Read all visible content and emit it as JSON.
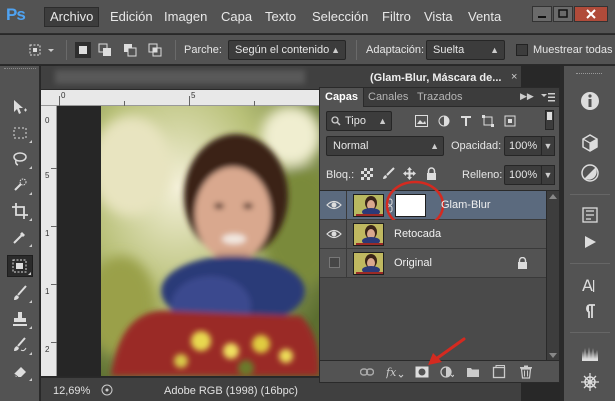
{
  "app": {
    "logo": "Ps"
  },
  "menu": {
    "items": [
      "Archivo",
      "Edición",
      "Imagen",
      "Capa",
      "Texto",
      "Selección",
      "Filtro",
      "Vista",
      "Venta"
    ],
    "active_index": 0
  },
  "options_bar": {
    "patch_label": "Parche:",
    "patch_value": "Según el contenido",
    "adaptation_label": "Adaptación:",
    "adaptation_value": "Suelta",
    "sample_all_label": "Muestrear todas"
  },
  "document": {
    "tab_title": "(Glam-Blur, Máscara de...",
    "close_glyph": "×",
    "zoom": "12,69%",
    "color_profile": "Adobe RGB (1998) (16bpc)",
    "ruler_top_marks": [
      "0",
      "5"
    ],
    "ruler_left_marks": [
      "0",
      "5",
      "1",
      "1",
      "2"
    ]
  },
  "layers_panel": {
    "tabs": [
      "Capas",
      "Canales",
      "Trazados"
    ],
    "active_tab": 0,
    "filter_kind": "Tipo",
    "blend_mode": "Normal",
    "opacity_label": "Opacidad:",
    "opacity_value": "100%",
    "lock_label": "Bloq.:",
    "fill_label": "Relleno:",
    "fill_value": "100%",
    "layers": [
      {
        "name": "Glam-Blur",
        "visible": true,
        "selected": true,
        "has_mask": true,
        "locked": false
      },
      {
        "name": "Retocada",
        "visible": true,
        "selected": false,
        "has_mask": false,
        "locked": false
      },
      {
        "name": "Original",
        "visible": false,
        "selected": false,
        "has_mask": false,
        "locked": true
      }
    ]
  },
  "colors": {
    "selection_highlight": "#5b6a7e",
    "annotation_red": "#d42a20",
    "ps_blue": "#4fa3f2"
  }
}
